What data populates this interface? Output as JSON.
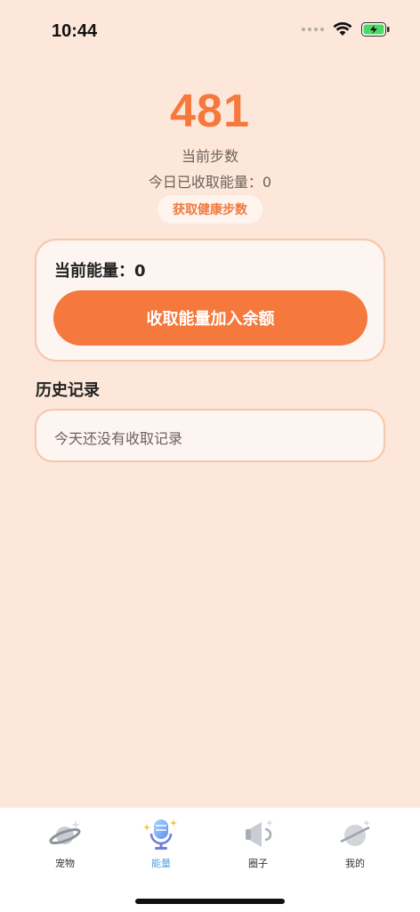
{
  "status_bar": {
    "time": "10:44"
  },
  "steps": {
    "value": "481",
    "label": "当前步数",
    "today_collected": "今日已收取能量：0",
    "health_button": "获取健康步数"
  },
  "energy_card": {
    "current_energy": "当前能量：0",
    "collect_button": "收取能量加入余额"
  },
  "history": {
    "title": "历史记录",
    "empty_text": "今天还没有收取记录"
  },
  "colors": {
    "accent": "#f5793c",
    "background": "#fde7da",
    "active_tab": "#4aa6e8"
  },
  "tab_bar": {
    "tabs": [
      {
        "label": "宠物",
        "icon": "planet-icon",
        "active": false
      },
      {
        "label": "能量",
        "icon": "microphone-icon",
        "active": true
      },
      {
        "label": "圈子",
        "icon": "megaphone-icon",
        "active": false
      },
      {
        "label": "我的",
        "icon": "planet-ring-icon",
        "active": false
      }
    ]
  }
}
